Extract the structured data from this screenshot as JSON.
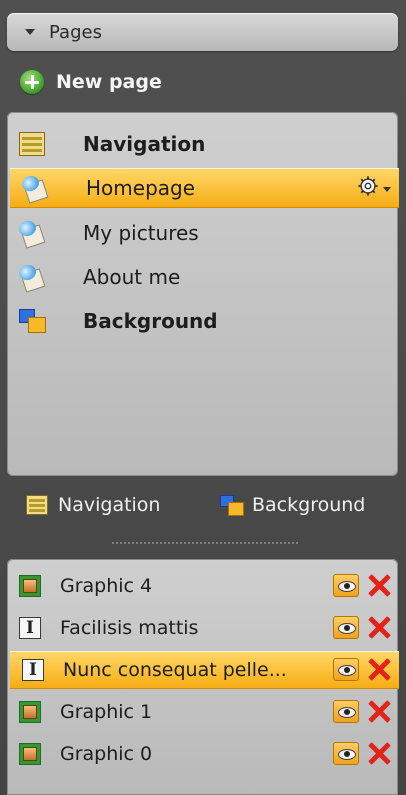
{
  "header": {
    "title": "Pages"
  },
  "new_page": {
    "label": "New page"
  },
  "pages": [
    {
      "label": "Navigation",
      "icon": "navigation-icon",
      "bold": true
    },
    {
      "label": "Homepage",
      "icon": "page-icon",
      "selected": true
    },
    {
      "label": "My pictures",
      "icon": "page-icon"
    },
    {
      "label": "About me",
      "icon": "page-icon"
    },
    {
      "label": "Background",
      "icon": "background-icon",
      "bold": true
    }
  ],
  "tabs": [
    {
      "label": "Navigation",
      "icon": "navigation-icon"
    },
    {
      "label": "Background",
      "icon": "background-icon"
    }
  ],
  "layers": [
    {
      "label": "Graphic 4",
      "icon": "graphic-icon"
    },
    {
      "label": "Facilisis mattis",
      "icon": "text-icon"
    },
    {
      "label": "Nunc consequat pelle...",
      "icon": "text-icon",
      "selected": true
    },
    {
      "label": "Graphic 1",
      "icon": "graphic-icon"
    },
    {
      "label": "Graphic 0",
      "icon": "graphic-icon"
    }
  ],
  "colors": {
    "selection": "#f6ac12",
    "delete": "#e2231a",
    "panel": "#c4c4c4",
    "background": "#4a4a4a"
  }
}
